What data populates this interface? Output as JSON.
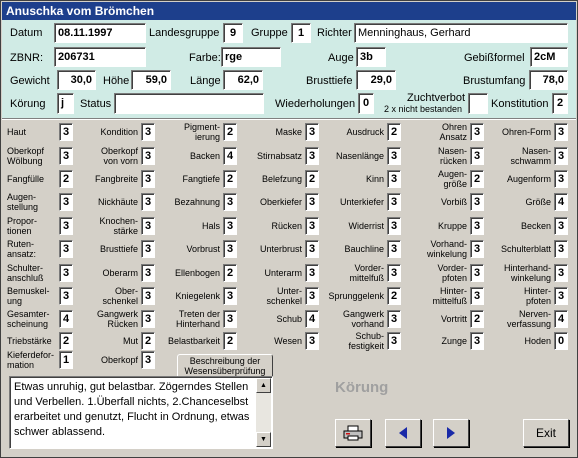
{
  "window": {
    "title": "Anuschka vom Brömchen"
  },
  "header": {
    "datum_label": "Datum",
    "datum": "08.11.1997",
    "landesgruppe_label": "Landesgruppe",
    "landesgruppe": "9",
    "gruppe_label": "Gruppe",
    "gruppe": "1",
    "richter_label": "Richter",
    "richter": "Menninghaus, Gerhard",
    "zbnr_label": "ZBNR:",
    "zbnr": "206731",
    "farbe_label": "Farbe:",
    "farbe": "rge",
    "auge_label": "Auge",
    "auge": "3b",
    "gebissformel_label": "Gebißformel",
    "gebissformel": "2cM",
    "gewicht_label": "Gewicht",
    "gewicht": "30,0",
    "hoehe_label": "Höhe",
    "hoehe": "59,0",
    "laenge_label": "Länge",
    "laenge": "62,0",
    "brusttiefe_label": "Brusttiefe",
    "brusttiefe": "29,0",
    "brustumfang_label": "Brustumfang",
    "brustumfang": "78,0",
    "koerung_label": "Körung",
    "koerung": "j",
    "status_label": "Status",
    "status": "",
    "wiederholungen_label": "Wiederholungen",
    "wiederholungen": "0",
    "zuchtverbot_label": "Zuchtverbot",
    "zuchtverbot_sub": "2 x nicht bestanden",
    "zuchtverbot": "",
    "konstitution_label": "Konstitution",
    "konstitution": "2"
  },
  "columns": [
    [
      {
        "l": "Haut",
        "v": "3"
      },
      {
        "l": "Oberkopf\nWölbung",
        "v": "3"
      },
      {
        "l": "Fangfülle",
        "v": "2"
      },
      {
        "l": "Augen-\nstellung",
        "v": "3"
      },
      {
        "l": "Propor-\ntionen",
        "v": "3"
      },
      {
        "l": "Ruten-\nansatz:",
        "v": "3"
      },
      {
        "l": "Schulter-\nanschluß",
        "v": "3"
      },
      {
        "l": "Bemuskel-\nung",
        "v": "3"
      },
      {
        "l": "Gesamter-\nscheinung",
        "v": "4"
      },
      {
        "l": "Triebstärke",
        "v": "2"
      },
      {
        "l": "Kieferdefor-\nmation",
        "v": "1"
      }
    ],
    [
      {
        "l": "Kondition",
        "v": "3"
      },
      {
        "l": "Oberkopf\nvon vorn",
        "v": "3"
      },
      {
        "l": "Fangbreite",
        "v": "3"
      },
      {
        "l": "Nickhäute",
        "v": "3"
      },
      {
        "l": "Knochen-\nstärke",
        "v": "3"
      },
      {
        "l": "Brusttiefe",
        "v": "3"
      },
      {
        "l": "Oberarm",
        "v": "3"
      },
      {
        "l": "Ober-\nschenkel",
        "v": "3"
      },
      {
        "l": "Gangwerk\nRücken",
        "v": "3"
      },
      {
        "l": "Mut",
        "v": "2"
      },
      {
        "l": "Oberkopf",
        "v": "3"
      }
    ],
    [
      {
        "l": "Pigment-\nierung",
        "v": "2"
      },
      {
        "l": "Backen",
        "v": "4"
      },
      {
        "l": "Fangtiefe",
        "v": "2"
      },
      {
        "l": "Bezahnung",
        "v": "3"
      },
      {
        "l": "Hals",
        "v": "3"
      },
      {
        "l": "Vorbrust",
        "v": "3"
      },
      {
        "l": "Ellenbogen",
        "v": "2"
      },
      {
        "l": "Kniegelenk",
        "v": "3"
      },
      {
        "l": "Treten der\nHinterhand",
        "v": "3"
      },
      {
        "l": "Belastbarkeit",
        "v": "2"
      }
    ],
    [
      {
        "l": "Maske",
        "v": "3"
      },
      {
        "l": "Stirnabsatz",
        "v": "3"
      },
      {
        "l": "Belefzung",
        "v": "2"
      },
      {
        "l": "Oberkiefer",
        "v": "3"
      },
      {
        "l": "Rücken",
        "v": "3"
      },
      {
        "l": "Unterbrust",
        "v": "3"
      },
      {
        "l": "Unterarm",
        "v": "3"
      },
      {
        "l": "Unter-\nschenkel",
        "v": "3"
      },
      {
        "l": "Schub",
        "v": "4"
      },
      {
        "l": "Wesen",
        "v": "3"
      }
    ],
    [
      {
        "l": "Ausdruck",
        "v": "2"
      },
      {
        "l": "Nasenlänge",
        "v": "3"
      },
      {
        "l": "Kinn",
        "v": "3"
      },
      {
        "l": "Unterkiefer",
        "v": "3"
      },
      {
        "l": "Widerrist",
        "v": "3"
      },
      {
        "l": "Bauchline",
        "v": "3"
      },
      {
        "l": "Vorder-\nmittelfuß",
        "v": "3"
      },
      {
        "l": "Sprunggelenk",
        "v": "2"
      },
      {
        "l": "Gangwerk\nvorhand",
        "v": "3"
      },
      {
        "l": "Schub-\nfestigkeit",
        "v": "3"
      }
    ],
    [
      {
        "l": "Ohren\nAnsatz",
        "v": "3"
      },
      {
        "l": "Nasen-\nrücken",
        "v": "3"
      },
      {
        "l": "Augen-\ngröße",
        "v": "2"
      },
      {
        "l": "Vorbiß",
        "v": "3"
      },
      {
        "l": "Kruppe",
        "v": "3"
      },
      {
        "l": "Vorhand-\nwinkelung",
        "v": "3"
      },
      {
        "l": "Vorder-\npfoten",
        "v": "3"
      },
      {
        "l": "Hinter-\nmittelfuß",
        "v": "3"
      },
      {
        "l": "Vortritt",
        "v": "2"
      },
      {
        "l": "Zunge",
        "v": "3"
      }
    ],
    [
      {
        "l": "Ohren-Form",
        "v": "3"
      },
      {
        "l": "Nasen-\nschwamm",
        "v": "3"
      },
      {
        "l": "Augenform",
        "v": "3"
      },
      {
        "l": "Größe",
        "v": "4"
      },
      {
        "l": "Becken",
        "v": "3"
      },
      {
        "l": "Schulterblatt",
        "v": "3"
      },
      {
        "l": "Hinterhand-\nwinkelung",
        "v": "3"
      },
      {
        "l": "Hinter-\npfoten",
        "v": "3"
      },
      {
        "l": "Nerven-\nverfassung",
        "v": "4"
      },
      {
        "l": "Hoden",
        "v": "0"
      }
    ]
  ],
  "tab": {
    "label": "Beschreibung der Wesensüberprüfung"
  },
  "memo": {
    "text": "Etwas unruhig, gut belastbar. Zögerndes Stellen und Verbellen. 1.Überfall nichts, 2.Chanceselbst erarbeitet und genutzt, Flucht in Ordnung, etwas schwer ablassend."
  },
  "koerung_caption": "Körung",
  "buttons": {
    "exit": "Exit"
  },
  "colors": {
    "title_bg": "#1d3f8c",
    "header_bg": "#d0ebe5",
    "nav_arrow": "#1a2aa8"
  },
  "icons": [
    "printer-icon",
    "prev-arrow-icon",
    "next-arrow-icon"
  ]
}
